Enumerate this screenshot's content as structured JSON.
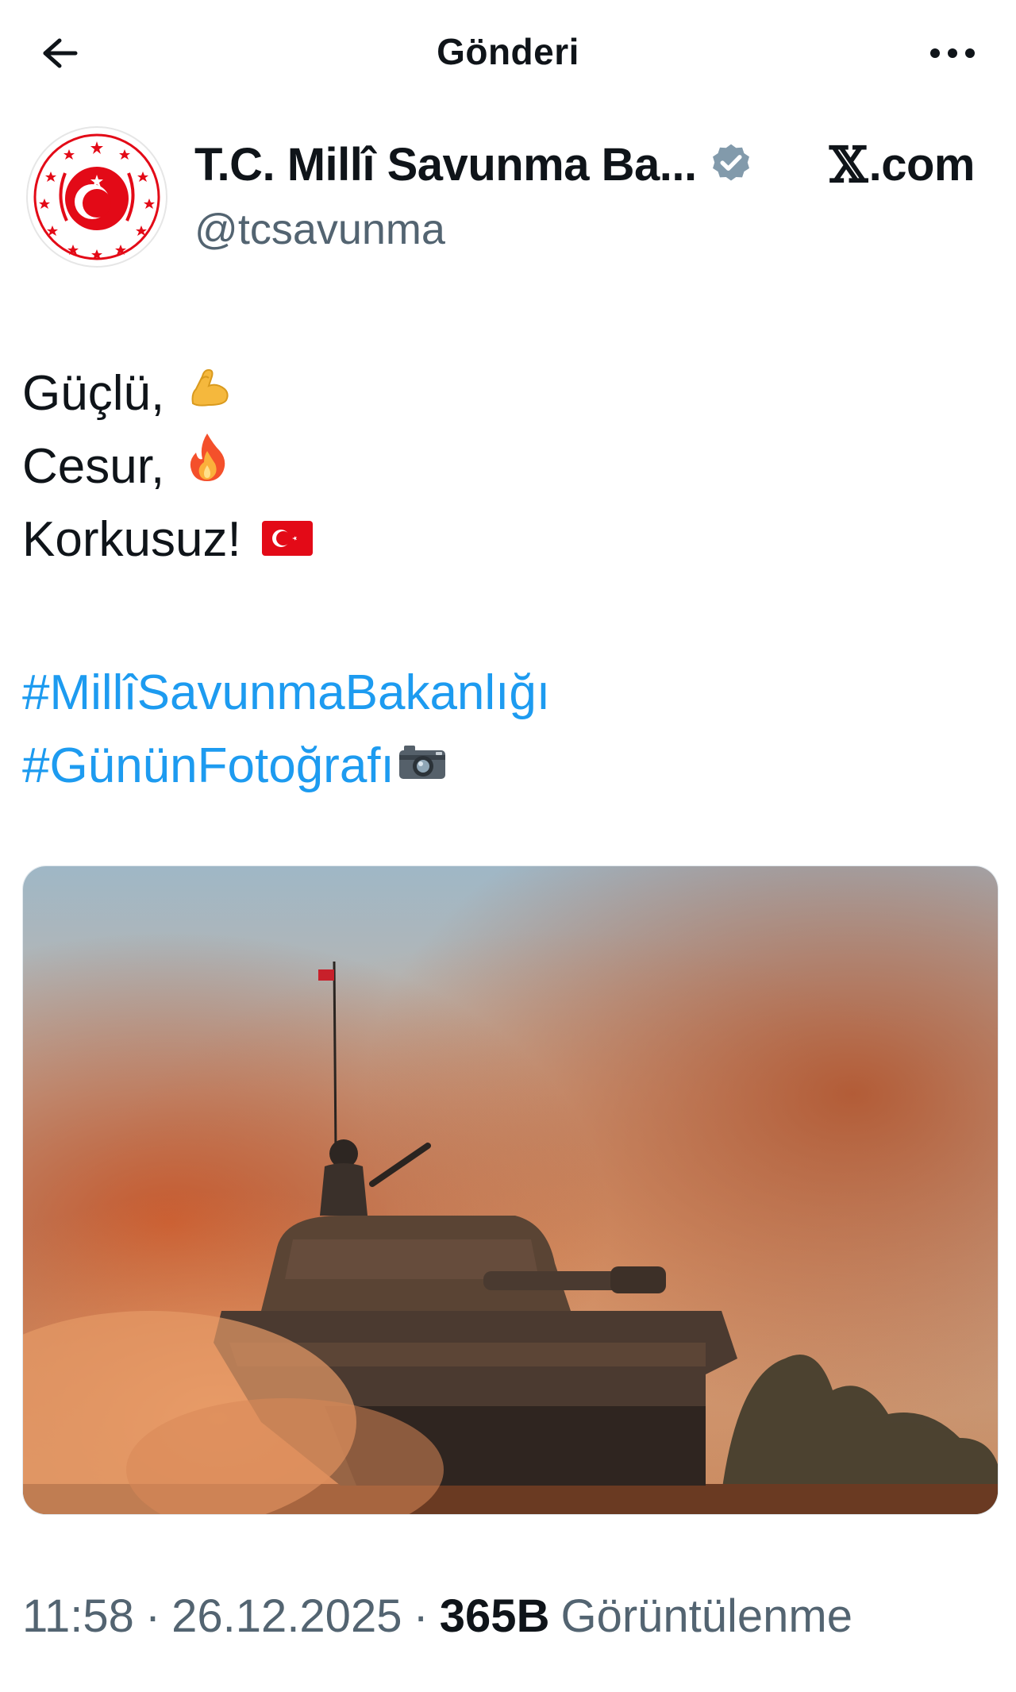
{
  "header": {
    "title": "Gönderi",
    "back_icon": "arrow-left-icon",
    "more_icon": "more-horizontal-icon"
  },
  "author": {
    "display_name": "T.C. Millî Savunma Ba...",
    "handle": "@tcsavunma",
    "verified": true,
    "verified_color": "#829aab",
    "avatar_icon": "turkish-ministry-of-defense-emblem"
  },
  "source": {
    "x_glyph": "𝕏",
    "label": ".com"
  },
  "tweet": {
    "lines": [
      {
        "text": "Güçlü,",
        "emoji": "flexed-biceps-icon"
      },
      {
        "text": "Cesur,",
        "emoji": "fire-icon"
      },
      {
        "text": "Korkusuz!",
        "emoji": "turkey-flag-icon"
      }
    ],
    "hashtags": [
      {
        "text": "#MillîSavunmaBakanlığı"
      },
      {
        "text": "#GününFotoğrafı",
        "emoji": "camera-icon"
      }
    ]
  },
  "media": {
    "description_icon": "tank-in-dust-photo"
  },
  "meta": {
    "time": "11:58",
    "separator": "·",
    "date": "26.12.2025",
    "views_count": "365B",
    "views_label": "Görüntülenme"
  },
  "colors": {
    "text": "#0f1419",
    "secondary": "#536471",
    "link": "#1d9bf0",
    "brand_red": "#e30a17"
  }
}
